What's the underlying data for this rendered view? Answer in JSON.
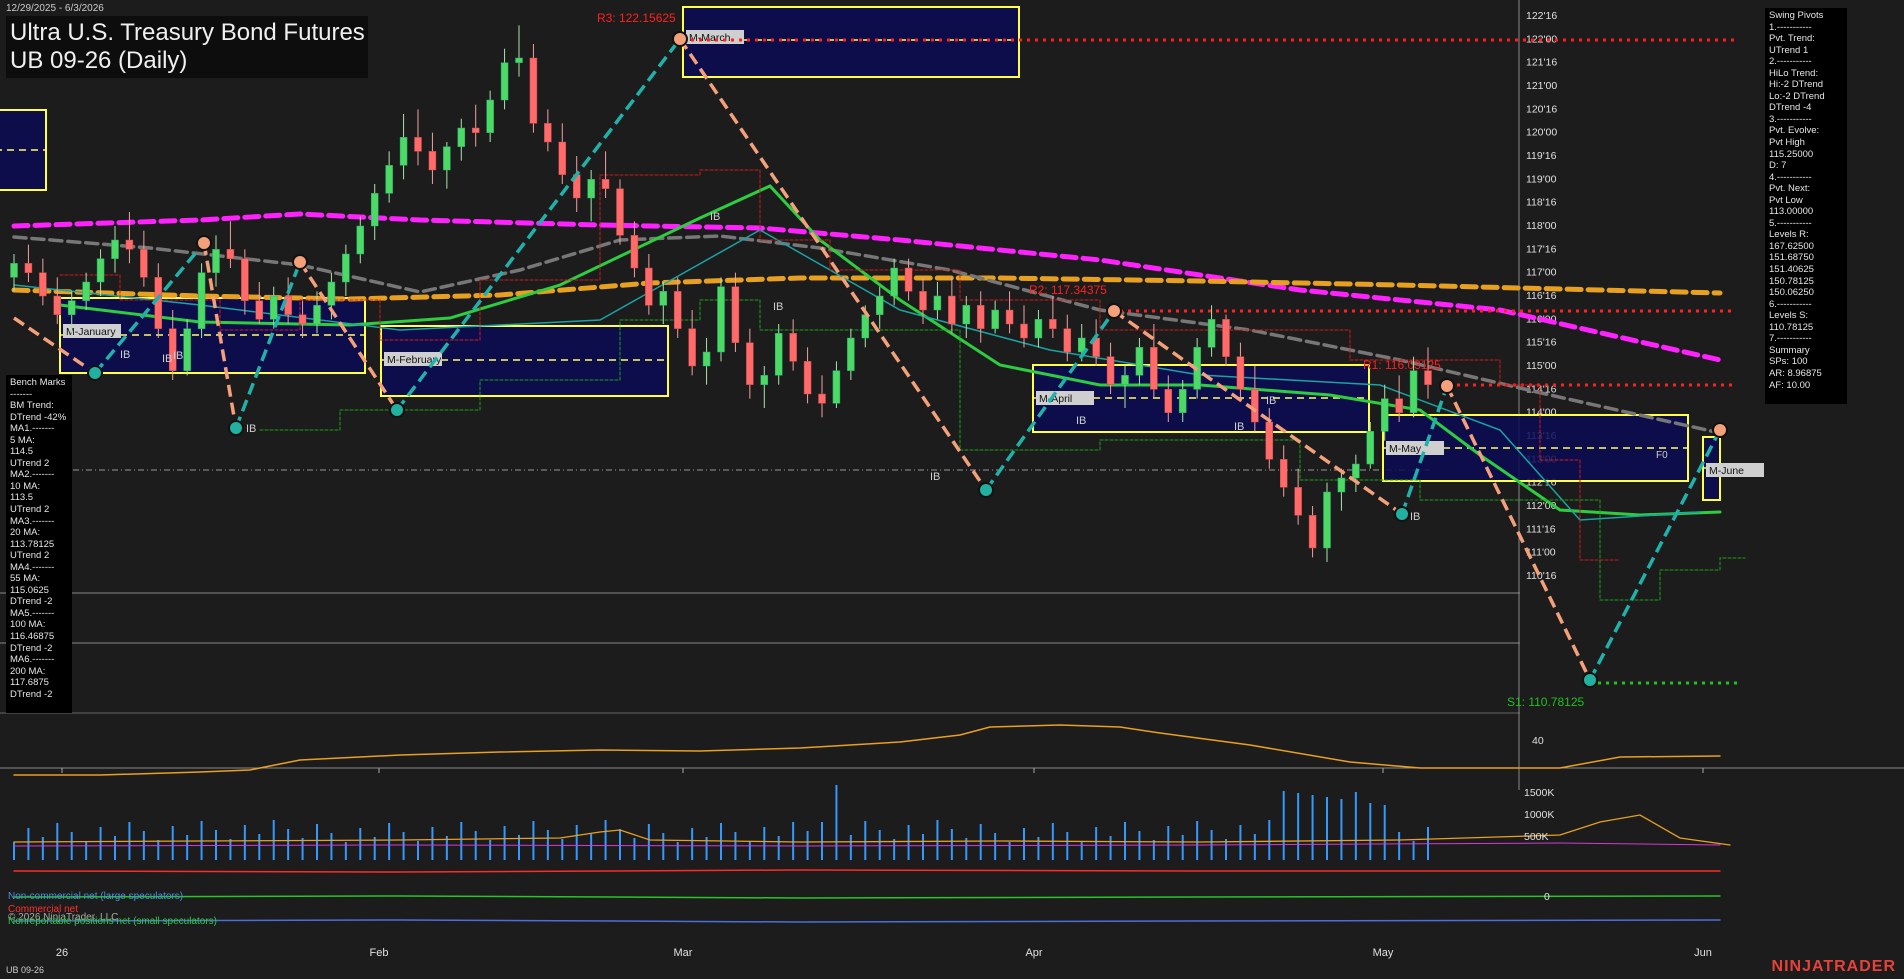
{
  "header": {
    "date_range": "12/29/2025 - 6/3/2026",
    "title_line1": "Ultra U.S. Treasury Bond Futures",
    "title_line2": "UB 09-26 (Daily)"
  },
  "footer": {
    "symbol": "UB 09-26",
    "brand": "NINJATRADER",
    "copyright": "© 2026 NinjaTrader, LLC"
  },
  "bench_marks": [
    "Bench Marks",
    "-------",
    "BM Trend:",
    "DTrend -42%",
    "MA1.-------",
    "5 MA:",
    "114.5",
    "UTrend 2",
    "MA2.-------",
    "10 MA:",
    "113.5",
    "UTrend 2",
    "MA3.-------",
    "20 MA:",
    "113.78125",
    "UTrend 2",
    "MA4.-------",
    "55 MA:",
    "115.0625",
    "DTrend -2",
    "MA5.-------",
    "100 MA:",
    "116.46875",
    "DTrend -2",
    "MA6.-------",
    "200 MA:",
    "117.6875",
    "DTrend -2"
  ],
  "swing_pivots": [
    "Swing Pivots",
    "1.-----------",
    "Pvt. Trend:",
    "UTrend 1",
    "2.-----------",
    "HiLo Trend:",
    "Hi:-2 DTrend",
    "Lo:-2 DTrend",
    "DTrend -4",
    "3.-----------",
    "Pvt. Evolve:",
    "Pvt High",
    "115.25000",
    "D: 7",
    "4.-----------",
    "Pvt. Next:",
    "Pvt Low",
    "113.00000",
    "5.-----------",
    "Levels R:",
    "167.62500",
    "151.68750",
    "151.40625",
    "150.78125",
    "150.06250",
    "6.-----------",
    "Levels S:",
    "110.78125",
    "7.-----------",
    "Summary",
    "SPs: 100",
    "AR: 8.96875",
    "AF: 10.00"
  ],
  "levels": {
    "r3": "R3: 122.15625",
    "r2": "R2: 117.34375",
    "r1": "R1: 116.03125",
    "s1": "S1: 110.78125"
  },
  "month_boxes": [
    "M-January",
    "M-February",
    "M-March",
    "M-April",
    "M-May",
    "M-June"
  ],
  "legends": {
    "noncommercial": "Non-commercial net (large speculators)",
    "commercial": "Commercial net",
    "nonreportable": "Nonreportable positions net (small speculators)"
  },
  "colors": {
    "background": "#1c1c1c",
    "ma_green": "#2ecc40",
    "ma_gray": "#777777",
    "ma_magenta": "#ff22ff",
    "ma_orange": "#e8a020",
    "swing_up": "#20b2aa",
    "swing_down": "#f4a07a",
    "resistance": "#ff2020",
    "support": "#1fc01f",
    "month_box": "#0a0a55",
    "month_border": "#ffff44",
    "volume": "#3399ff"
  },
  "chart_data": {
    "type": "candlestick",
    "price_axis": {
      "min": 110.25,
      "max": 122.5,
      "ticks": [
        "122'16",
        "122'00",
        "121'16",
        "121'00",
        "120'16",
        "120'00",
        "119'16",
        "119'00",
        "118'16",
        "118'00",
        "117'16",
        "117'00",
        "116'16",
        "116'00",
        "115'16",
        "115'00",
        "114'16",
        "114'00",
        "113'16",
        "113'00",
        "112'16",
        "112'00",
        "111'16",
        "111'00",
        "110'16"
      ]
    },
    "x_axis": {
      "labels": [
        "26",
        "Feb",
        "Mar",
        "Apr",
        "May",
        "Jun"
      ]
    },
    "ib_labels": [
      "IB",
      "IB",
      "IB",
      "IB",
      "IB",
      "IB",
      "IB",
      "IB",
      "IB",
      "IB",
      "IB"
    ],
    "f0_label": "F0",
    "ohlc": [
      [
        116.9,
        117.4,
        116.6,
        117.2
      ],
      [
        117.2,
        117.6,
        116.8,
        117.0
      ],
      [
        117.0,
        117.3,
        116.3,
        116.5
      ],
      [
        116.5,
        116.9,
        115.9,
        116.1
      ],
      [
        116.1,
        116.6,
        115.7,
        116.4
      ],
      [
        116.4,
        117.0,
        116.2,
        116.8
      ],
      [
        116.8,
        117.5,
        116.5,
        117.3
      ],
      [
        117.3,
        118.0,
        117.0,
        117.7
      ],
      [
        117.7,
        118.3,
        117.2,
        117.5
      ],
      [
        117.5,
        117.9,
        116.7,
        116.9
      ],
      [
        116.9,
        117.2,
        115.6,
        115.8
      ],
      [
        115.8,
        116.2,
        114.7,
        114.9
      ],
      [
        114.9,
        116.0,
        114.8,
        115.8
      ],
      [
        115.8,
        117.2,
        115.6,
        117.0
      ],
      [
        117.0,
        117.8,
        116.7,
        117.5
      ],
      [
        117.5,
        118.1,
        117.1,
        117.3
      ],
      [
        117.3,
        117.5,
        116.1,
        116.4
      ],
      [
        116.4,
        116.8,
        115.9,
        116.0
      ],
      [
        116.0,
        116.7,
        115.8,
        116.5
      ],
      [
        116.5,
        116.9,
        115.9,
        116.1
      ],
      [
        116.1,
        116.4,
        115.6,
        115.9
      ],
      [
        115.9,
        116.6,
        115.7,
        116.3
      ],
      [
        116.3,
        117.0,
        116.0,
        116.8
      ],
      [
        116.8,
        117.6,
        116.5,
        117.4
      ],
      [
        117.4,
        118.2,
        117.2,
        118.0
      ],
      [
        118.0,
        118.9,
        117.7,
        118.7
      ],
      [
        118.7,
        119.6,
        118.5,
        119.3
      ],
      [
        119.3,
        120.4,
        119.0,
        119.9
      ],
      [
        119.9,
        120.5,
        119.3,
        119.6
      ],
      [
        119.6,
        120.0,
        118.9,
        119.2
      ],
      [
        119.2,
        119.8,
        118.8,
        119.7
      ],
      [
        119.7,
        120.3,
        119.4,
        120.1
      ],
      [
        120.1,
        120.6,
        119.7,
        120.0
      ],
      [
        120.0,
        120.9,
        119.8,
        120.7
      ],
      [
        120.7,
        121.8,
        120.5,
        121.5
      ],
      [
        121.5,
        122.3,
        121.2,
        121.6
      ],
      [
        121.6,
        121.9,
        120.0,
        120.2
      ],
      [
        120.2,
        120.5,
        119.6,
        119.8
      ],
      [
        119.8,
        120.2,
        118.9,
        119.1
      ],
      [
        119.1,
        119.5,
        118.3,
        118.6
      ],
      [
        118.6,
        119.2,
        118.1,
        119.0
      ],
      [
        119.0,
        119.6,
        118.6,
        118.8
      ],
      [
        118.8,
        119.0,
        117.6,
        117.8
      ],
      [
        117.8,
        118.1,
        116.9,
        117.1
      ],
      [
        117.1,
        117.4,
        116.1,
        116.3
      ],
      [
        116.3,
        116.8,
        115.9,
        116.6
      ],
      [
        116.6,
        116.9,
        115.6,
        115.8
      ],
      [
        115.8,
        116.2,
        114.8,
        115.0
      ],
      [
        115.0,
        115.6,
        114.6,
        115.3
      ],
      [
        115.3,
        116.9,
        115.1,
        116.7
      ],
      [
        116.7,
        117.0,
        115.3,
        115.5
      ],
      [
        115.5,
        115.8,
        114.3,
        114.6
      ],
      [
        114.6,
        115.0,
        114.1,
        114.8
      ],
      [
        114.8,
        115.9,
        114.6,
        115.7
      ],
      [
        115.7,
        116.0,
        114.9,
        115.1
      ],
      [
        115.1,
        115.4,
        114.2,
        114.4
      ],
      [
        114.4,
        114.8,
        113.9,
        114.2
      ],
      [
        114.2,
        115.1,
        114.1,
        114.9
      ],
      [
        114.9,
        115.8,
        114.7,
        115.6
      ],
      [
        115.6,
        116.3,
        115.4,
        116.1
      ],
      [
        116.1,
        116.7,
        115.8,
        116.5
      ],
      [
        116.5,
        117.3,
        116.3,
        117.1
      ],
      [
        117.1,
        117.3,
        116.4,
        116.6
      ],
      [
        116.6,
        116.9,
        115.9,
        116.2
      ],
      [
        116.2,
        116.8,
        116.0,
        116.5
      ],
      [
        116.5,
        116.9,
        115.7,
        115.9
      ],
      [
        115.9,
        116.5,
        115.6,
        116.3
      ],
      [
        116.3,
        116.6,
        115.5,
        115.8
      ],
      [
        115.8,
        116.4,
        115.7,
        116.2
      ],
      [
        116.2,
        116.6,
        115.7,
        115.9
      ],
      [
        115.9,
        116.3,
        115.4,
        115.6
      ],
      [
        115.6,
        116.2,
        115.4,
        116.0
      ],
      [
        116.0,
        116.5,
        115.6,
        115.8
      ],
      [
        115.8,
        116.1,
        115.1,
        115.3
      ],
      [
        115.3,
        115.9,
        115.1,
        115.6
      ],
      [
        115.6,
        116.0,
        115.0,
        115.2
      ],
      [
        115.2,
        115.5,
        114.4,
        114.6
      ],
      [
        114.6,
        115.0,
        114.1,
        114.8
      ],
      [
        114.8,
        115.6,
        114.6,
        115.4
      ],
      [
        115.4,
        115.9,
        114.3,
        114.5
      ],
      [
        114.5,
        114.8,
        113.8,
        114.0
      ],
      [
        114.0,
        114.7,
        113.8,
        114.5
      ],
      [
        114.5,
        115.6,
        114.3,
        115.4
      ],
      [
        115.4,
        116.3,
        115.2,
        116.0
      ],
      [
        116.0,
        116.1,
        115.0,
        115.2
      ],
      [
        115.2,
        115.5,
        114.3,
        114.5
      ],
      [
        114.5,
        115.0,
        113.6,
        113.8
      ],
      [
        113.8,
        114.1,
        112.8,
        113.0
      ],
      [
        113.0,
        113.3,
        112.2,
        112.4
      ],
      [
        112.4,
        112.8,
        111.6,
        111.8
      ],
      [
        111.8,
        112.0,
        110.9,
        111.1
      ],
      [
        111.1,
        112.5,
        110.8,
        112.3
      ],
      [
        112.3,
        112.8,
        111.9,
        112.6
      ],
      [
        112.6,
        113.1,
        112.3,
        112.9
      ],
      [
        112.9,
        113.8,
        112.8,
        113.6
      ],
      [
        113.6,
        114.6,
        113.4,
        114.3
      ],
      [
        114.3,
        114.8,
        113.8,
        114.0
      ],
      [
        114.0,
        115.2,
        113.9,
        114.9
      ],
      [
        114.9,
        115.4,
        114.3,
        114.6
      ]
    ],
    "moving_averages": [
      {
        "name": "5 MA",
        "value": 114.5
      },
      {
        "name": "10 MA",
        "value": 113.5
      },
      {
        "name": "20 MA",
        "value": 113.78125
      },
      {
        "name": "55 MA",
        "value": 115.0625
      },
      {
        "name": "100 MA",
        "value": 116.46875
      },
      {
        "name": "200 MA",
        "value": 117.6875
      }
    ],
    "volume_axis": {
      "ticks": [
        "1500K",
        "1000K",
        "500K"
      ]
    },
    "oscillator_axis": {
      "ticks": [
        "40"
      ]
    },
    "cot_axis": {
      "ticks": [
        "0"
      ]
    }
  }
}
